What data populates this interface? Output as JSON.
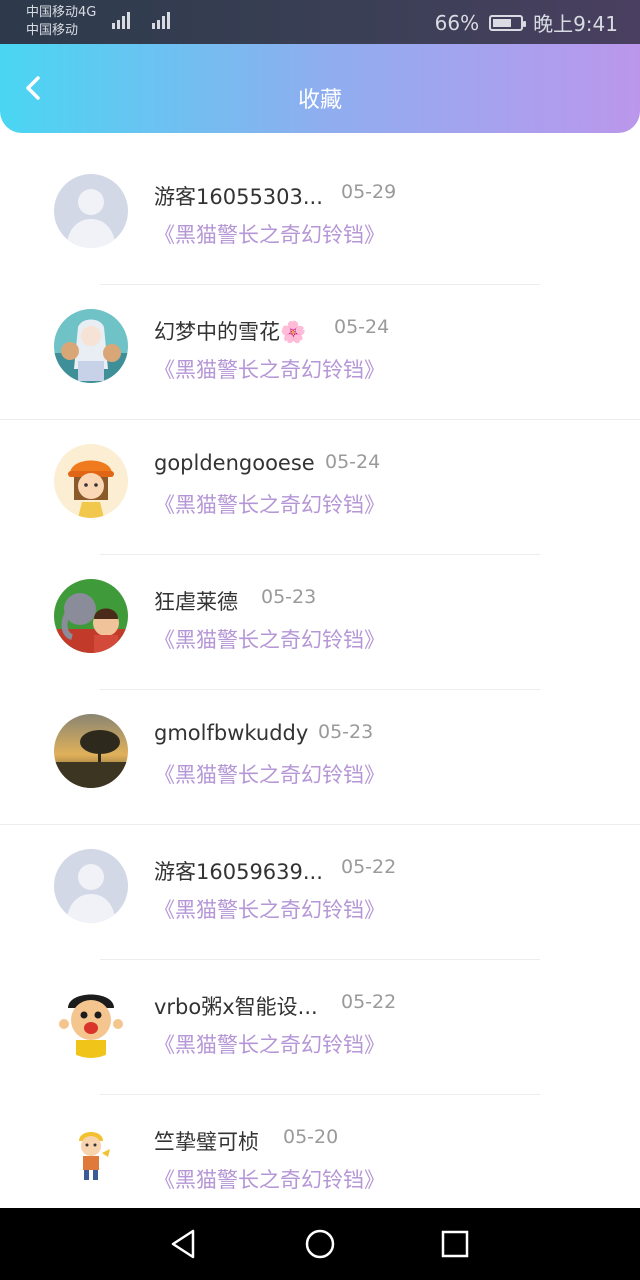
{
  "status": {
    "carrier1": "中国移动",
    "net1": "4G",
    "carrier2": "中国移动",
    "battery": "66%",
    "time": "晚上9:41"
  },
  "header": {
    "title": "收藏"
  },
  "items": [
    {
      "name": "游客16055303...",
      "date": "05-29",
      "work": "《黑猫警长之奇幻铃铛》",
      "avatar": "default-avatar"
    },
    {
      "name": "幻梦中的雪花🌸",
      "date": "05-24",
      "work": "《黑猫警长之奇幻铃铛》",
      "avatar": "anime-girl-avatar"
    },
    {
      "name": "gopldengooese",
      "date": "05-24",
      "work": "《黑猫警长之奇幻铃铛》",
      "avatar": "cartoon-girl-hat-avatar"
    },
    {
      "name": "狂虐莱德",
      "date": "05-23",
      "work": "《黑猫警长之奇幻铃铛》",
      "avatar": "cartoon-elephant-avatar"
    },
    {
      "name": "gmolfbwkuddy",
      "date": "05-23",
      "work": "《黑猫警长之奇幻铃铛》",
      "avatar": "sunset-tree-avatar"
    },
    {
      "name": "游客16059639...",
      "date": "05-22",
      "work": "《黑猫警长之奇幻铃铛》",
      "avatar": "default-avatar"
    },
    {
      "name": "vrbo粥x智能设...",
      "date": "05-22",
      "work": "《黑猫警长之奇幻铃铛》",
      "avatar": "cartoon-boy-avatar"
    },
    {
      "name": "竺挚璧可桢",
      "date": "05-20",
      "work": "《黑猫警长之奇幻铃铛》",
      "avatar": "cartoon-kid-avatar"
    }
  ],
  "colors": {
    "accent": "#b596d6",
    "header_start": "#49d6f3",
    "header_end": "#bb97ec"
  }
}
